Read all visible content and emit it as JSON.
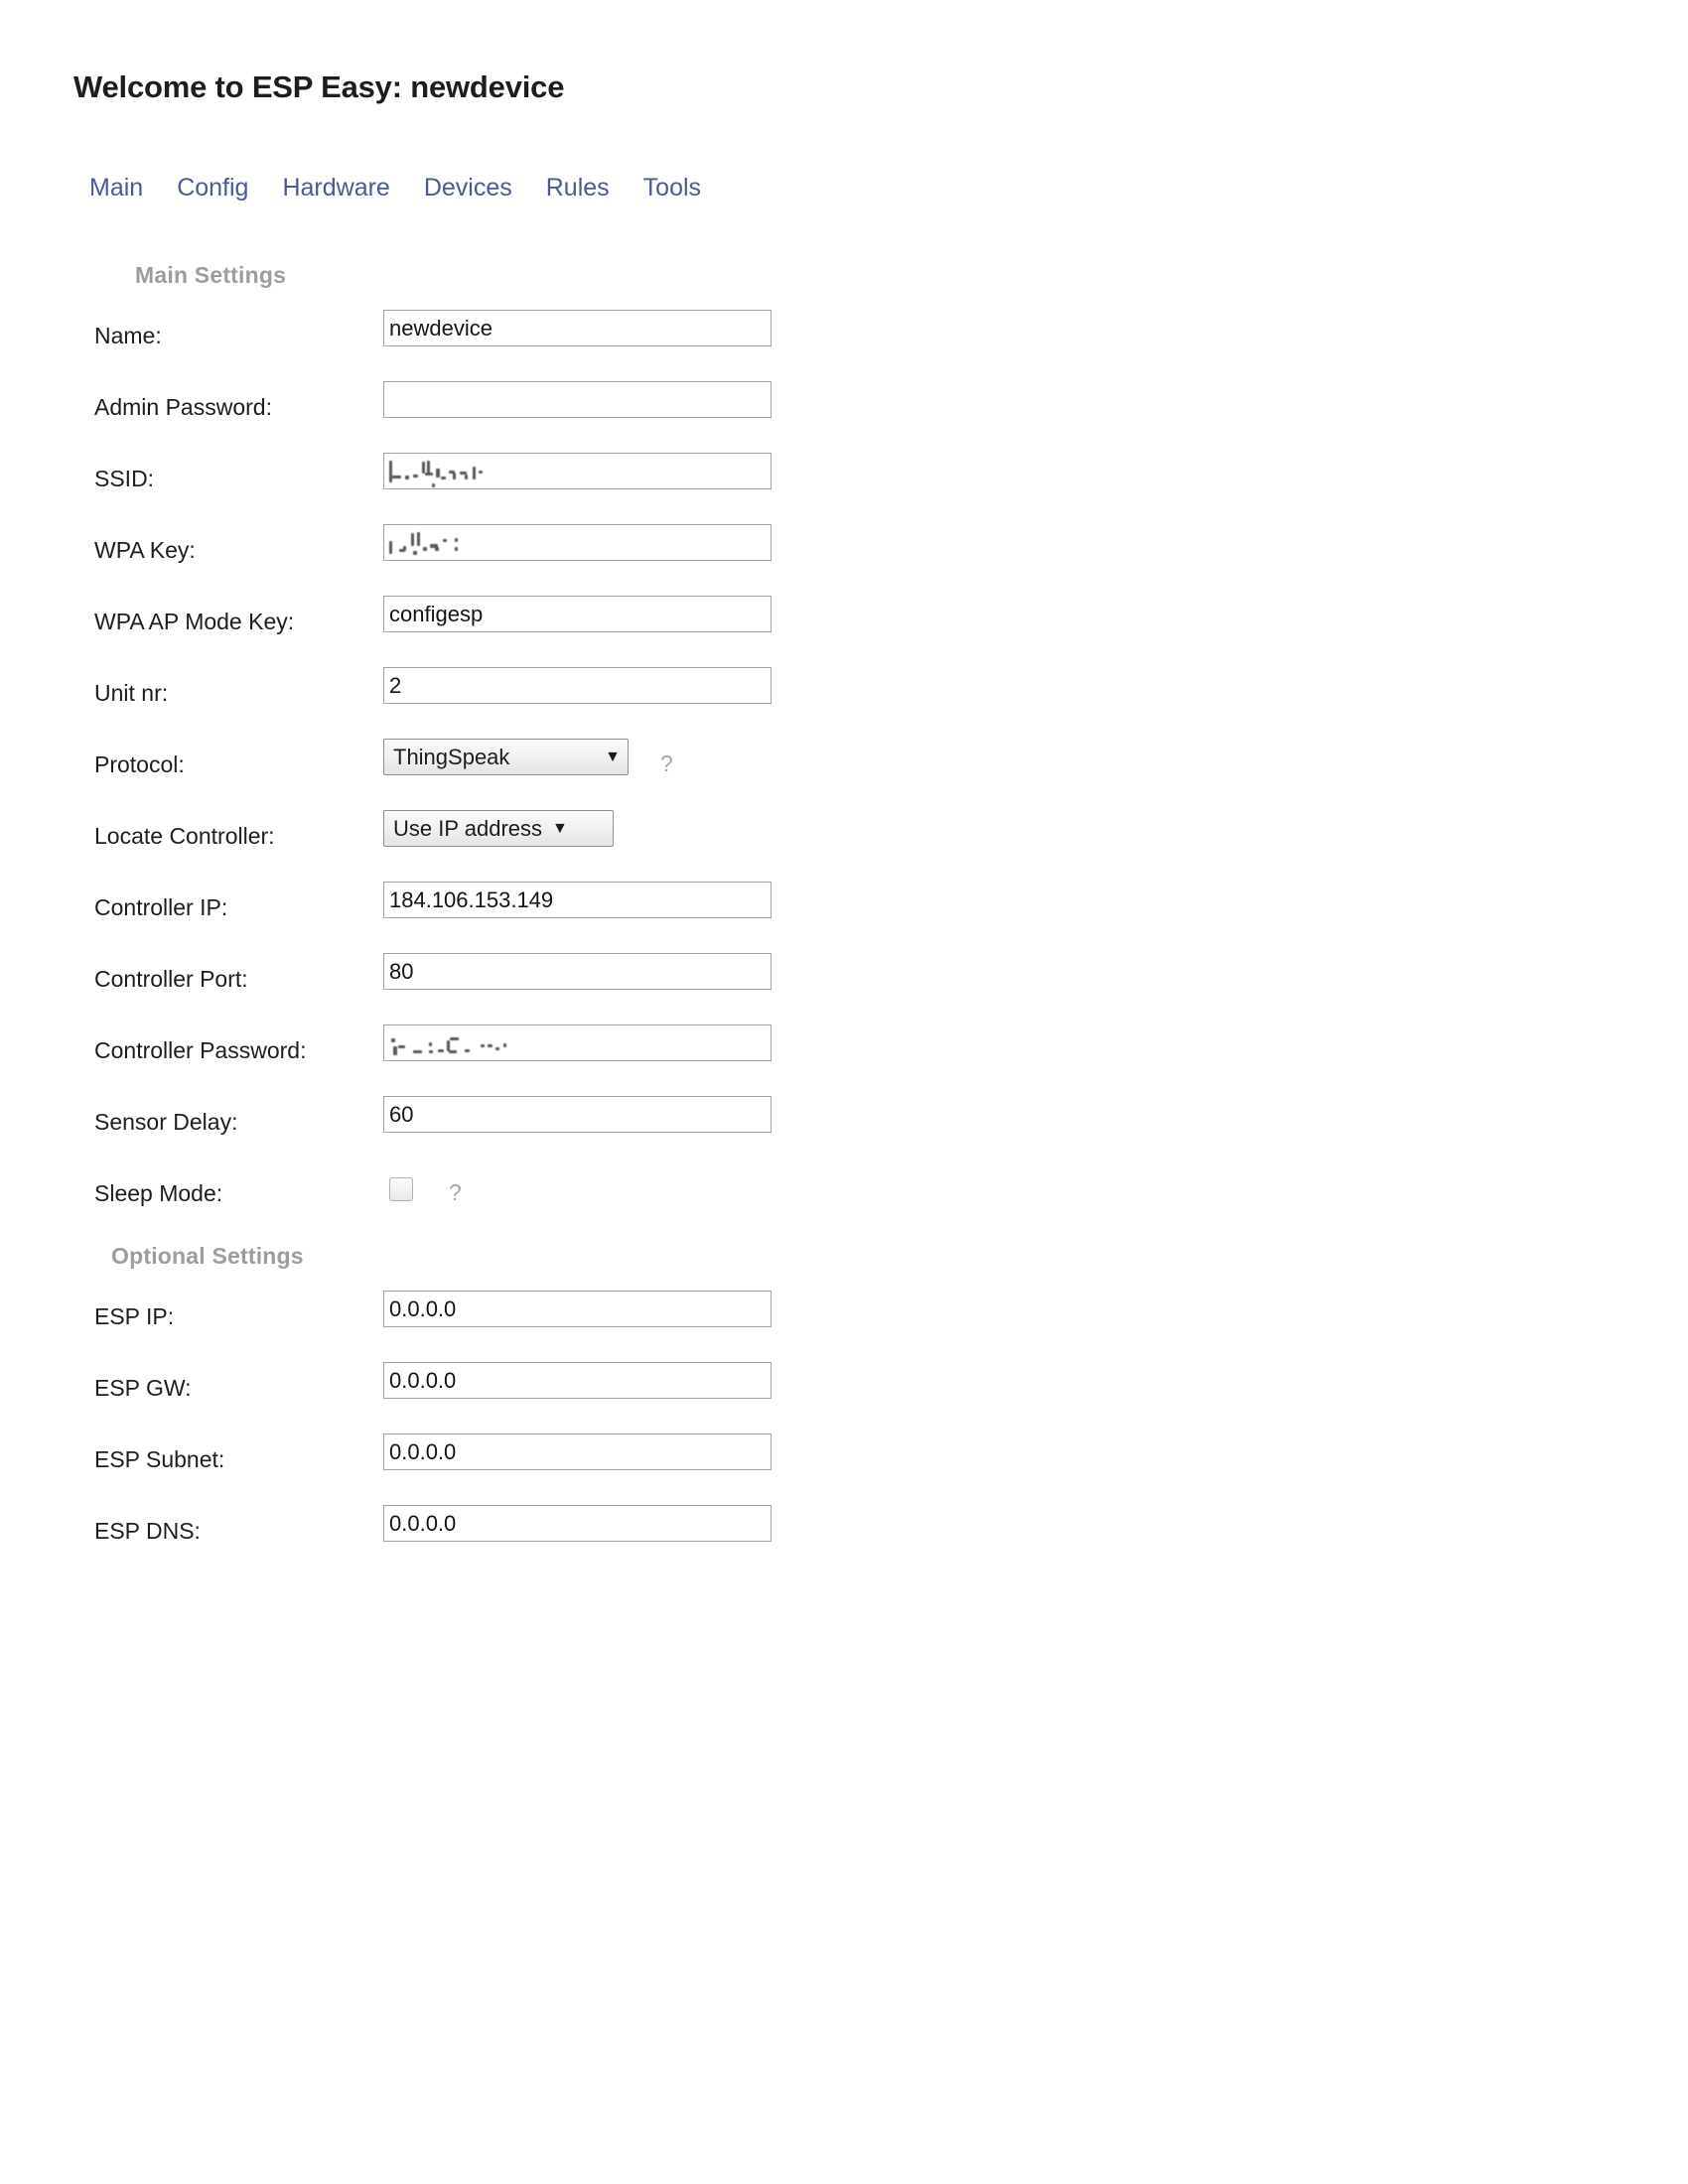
{
  "page": {
    "title": "Welcome to ESP Easy: newdevice",
    "accent_link_color": "#4a5a96",
    "section_label_color": "#9d9d9d"
  },
  "nav": {
    "items": [
      {
        "label": "Main"
      },
      {
        "label": "Config"
      },
      {
        "label": "Hardware"
      },
      {
        "label": "Devices"
      },
      {
        "label": "Rules"
      },
      {
        "label": "Tools"
      }
    ]
  },
  "sections": {
    "main": {
      "header": "Main Settings"
    },
    "optional": {
      "header": "Optional Settings"
    }
  },
  "fields": {
    "name": {
      "label": "Name:",
      "value": "newdevice"
    },
    "admin_password": {
      "label": "Admin Password:",
      "value": ""
    },
    "ssid": {
      "label": "SSID:",
      "value": ""
    },
    "wpa_key": {
      "label": "WPA Key:",
      "value": ""
    },
    "wpa_ap_mode_key": {
      "label": "WPA AP Mode Key:",
      "value": "configesp"
    },
    "unit_nr": {
      "label": "Unit nr:",
      "value": "2"
    },
    "protocol": {
      "label": "Protocol:",
      "value": "ThingSpeak",
      "help": "?"
    },
    "locate_controller": {
      "label": "Locate Controller:",
      "value": "Use IP address"
    },
    "controller_ip": {
      "label": "Controller IP:",
      "value": "184.106.153.149"
    },
    "controller_port": {
      "label": "Controller Port:",
      "value": "80"
    },
    "controller_password": {
      "label": "Controller Password:",
      "value": ""
    },
    "sensor_delay": {
      "label": "Sensor Delay:",
      "value": "60"
    },
    "sleep_mode": {
      "label": "Sleep Mode:",
      "checked": false,
      "help": "?"
    },
    "esp_ip": {
      "label": "ESP IP:",
      "value": "0.0.0.0"
    },
    "esp_gw": {
      "label": "ESP GW:",
      "value": "0.0.0.0"
    },
    "esp_subnet": {
      "label": "ESP Subnet:",
      "value": "0.0.0.0"
    },
    "esp_dns": {
      "label": "ESP DNS:",
      "value": "0.0.0.0"
    }
  },
  "icons": {
    "dropdown_arrow": "▼"
  }
}
